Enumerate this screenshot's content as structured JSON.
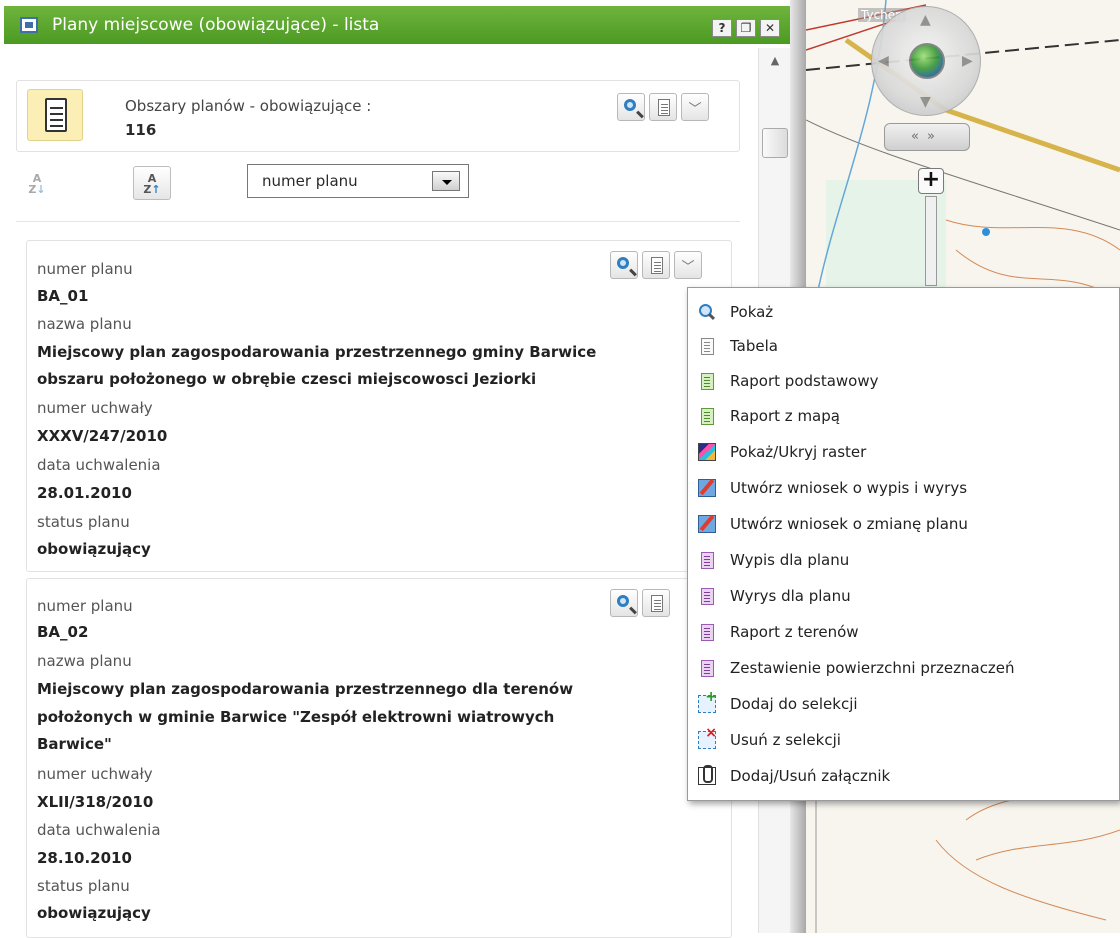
{
  "window": {
    "title": "Plany miejscowe (obowiązujące) - lista",
    "help_label": "?",
    "restore_label": "❐",
    "close_label": "✕"
  },
  "map": {
    "place_label": "Tychen"
  },
  "summary": {
    "label": "Obszary planów - obowiązujące :",
    "count": "116"
  },
  "sort": {
    "select_value": "numer planu"
  },
  "plans": [
    {
      "f1_label": "numer planu",
      "f1_value": "BA_01",
      "f2_label": "nazwa planu",
      "f2_value_line1": "Miejscowy plan zagospodarowania przestrzennego gminy Barwice",
      "f2_value_line2": "obszaru położonego w obrębie czesci miejscowosci Jeziorki",
      "f3_label": "numer uchwały",
      "f3_value": "XXXV/247/2010",
      "f4_label": "data uchwalenia",
      "f4_value": "28.01.2010",
      "f5_label": "status planu",
      "f5_value": "obowiązujący"
    },
    {
      "f1_label": "numer planu",
      "f1_value": "BA_02",
      "f2_label": "nazwa planu",
      "f2_value_line1": "Miejscowy plan zagospodarowania przestrzennego dla terenów",
      "f2_value_line2": "położonych w gminie Barwice \"Zespół elektrowni wiatrowych",
      "f2_value_line3": "Barwice\"",
      "f3_label": "numer uchwały",
      "f3_value": "XLII/318/2010",
      "f4_label": "data uchwalenia",
      "f4_value": "28.10.2010",
      "f5_label": "status planu",
      "f5_value": "obowiązujący"
    }
  ],
  "context_menu": {
    "items": [
      {
        "label": "Pokaż",
        "icon": "magnifier-icon"
      },
      {
        "label": "Tabela",
        "icon": "table-icon"
      },
      {
        "label": "Raport podstawowy",
        "icon": "report-green-icon"
      },
      {
        "label": "Raport z mapą",
        "icon": "report-green-icon"
      },
      {
        "label": "Pokaż/Ukryj raster",
        "icon": "raster-icon"
      },
      {
        "label": "Utwórz wniosek o wypis i wyrys",
        "icon": "edit-form-icon"
      },
      {
        "label": "Utwórz wniosek o zmianę planu",
        "icon": "edit-form-icon"
      },
      {
        "label": "Wypis dla planu",
        "icon": "report-purple-icon"
      },
      {
        "label": "Wyrys dla planu",
        "icon": "report-purple-icon"
      },
      {
        "label": "Raport z terenów",
        "icon": "report-purple-icon"
      },
      {
        "label": "Zestawienie powierzchni przeznaczeń",
        "icon": "report-purple-icon"
      },
      {
        "label": "Dodaj do selekcji",
        "icon": "selection-add-icon"
      },
      {
        "label": "Usuń z selekcji",
        "icon": "selection-remove-icon"
      },
      {
        "label": "Dodaj/Usuń załącznik",
        "icon": "attachment-icon"
      }
    ]
  },
  "colors": {
    "titlebar": "#5aa62e",
    "menu_border": "#9a9a9a",
    "link_blue": "#2f7ec1"
  }
}
